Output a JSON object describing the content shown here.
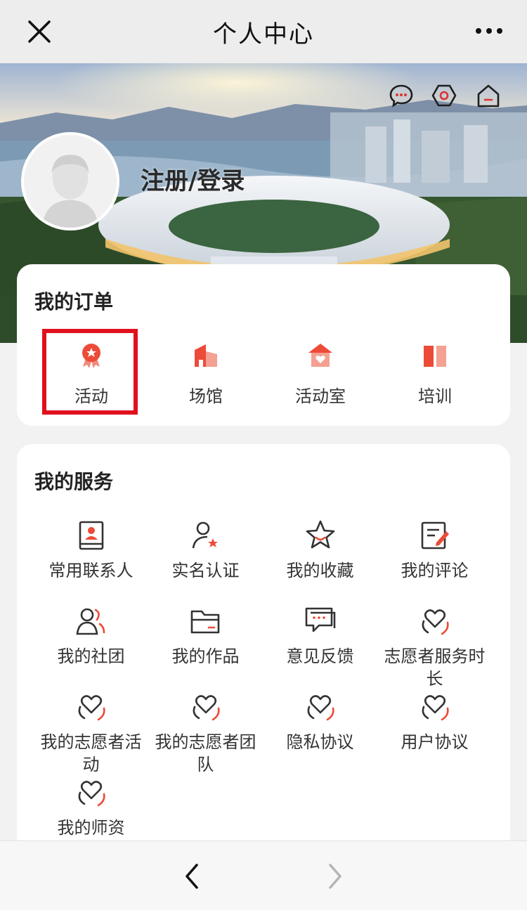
{
  "navbar": {
    "title": "个人中心"
  },
  "banner": {
    "login_label": "注册/登录"
  },
  "orders": {
    "title": "我的订单",
    "items": [
      {
        "label": "活动",
        "icon": "activity-badge-icon"
      },
      {
        "label": "场馆",
        "icon": "venue-icon"
      },
      {
        "label": "活动室",
        "icon": "activity-room-icon"
      },
      {
        "label": "培训",
        "icon": "training-book-icon"
      }
    ]
  },
  "services": {
    "title": "我的服务",
    "items": [
      {
        "label": "常用联系人",
        "icon": "contact-book-icon"
      },
      {
        "label": "实名认证",
        "icon": "user-verify-icon"
      },
      {
        "label": "我的收藏",
        "icon": "star-icon"
      },
      {
        "label": "我的评论",
        "icon": "comment-edit-icon"
      },
      {
        "label": "我的社团",
        "icon": "group-icon"
      },
      {
        "label": "我的作品",
        "icon": "folder-icon"
      },
      {
        "label": "意见反馈",
        "icon": "feedback-icon"
      },
      {
        "label": "志愿者服务时长",
        "icon": "volunteer-heart-icon"
      },
      {
        "label": "我的志愿者活动",
        "icon": "volunteer-heart-icon"
      },
      {
        "label": "我的志愿者团队",
        "icon": "volunteer-heart-icon"
      },
      {
        "label": "隐私协议",
        "icon": "volunteer-heart-icon"
      },
      {
        "label": "用户协议",
        "icon": "volunteer-heart-icon"
      },
      {
        "label": "我的师资",
        "icon": "volunteer-heart-icon"
      }
    ]
  },
  "colors": {
    "accent": "#ec4b38",
    "highlight": "#e0101e",
    "icon_stroke": "#333333"
  }
}
